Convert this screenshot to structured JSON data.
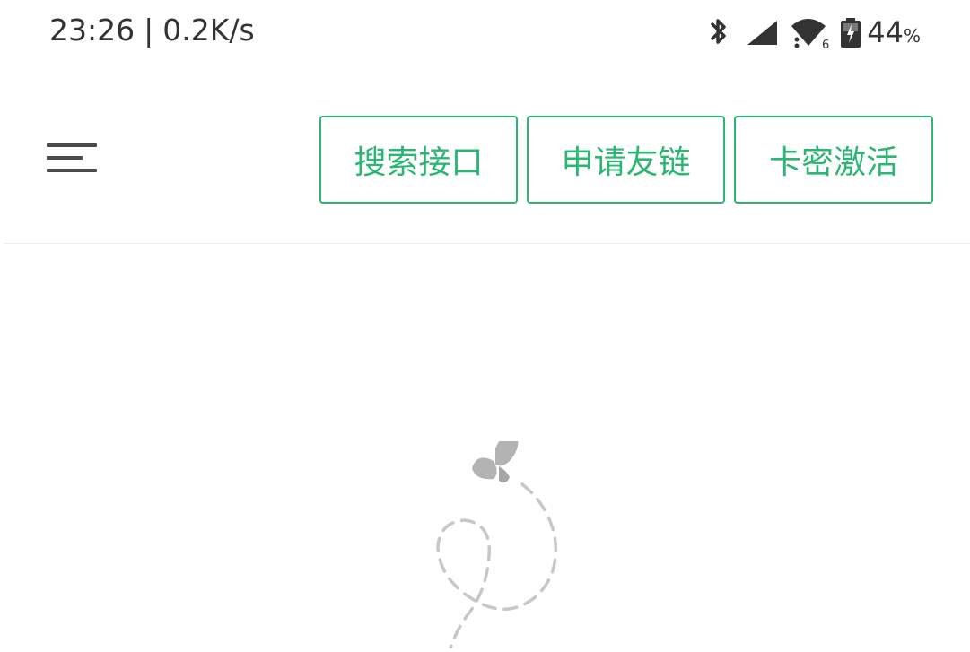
{
  "status_bar": {
    "time": "23:26",
    "separator": "|",
    "network_speed": "0.2K/s",
    "wifi_sub": "6",
    "battery_level": "44",
    "battery_unit": "%",
    "icons": [
      "bluetooth-icon",
      "cell-signal-icon",
      "wifi-icon",
      "battery-charging-icon"
    ]
  },
  "header": {
    "menu_icon": "hamburger-menu-icon",
    "buttons": {
      "search_api": "搜索接口",
      "apply_friend_link": "申请友链",
      "activate_card_key": "卡密激活"
    }
  },
  "theme": {
    "accent": "#2bb673",
    "text": "#333333",
    "icon_gray": "#4a4a4a",
    "divider": "#ececec"
  },
  "main": {
    "illustration": "butterfly-dashed-path-illustration"
  }
}
